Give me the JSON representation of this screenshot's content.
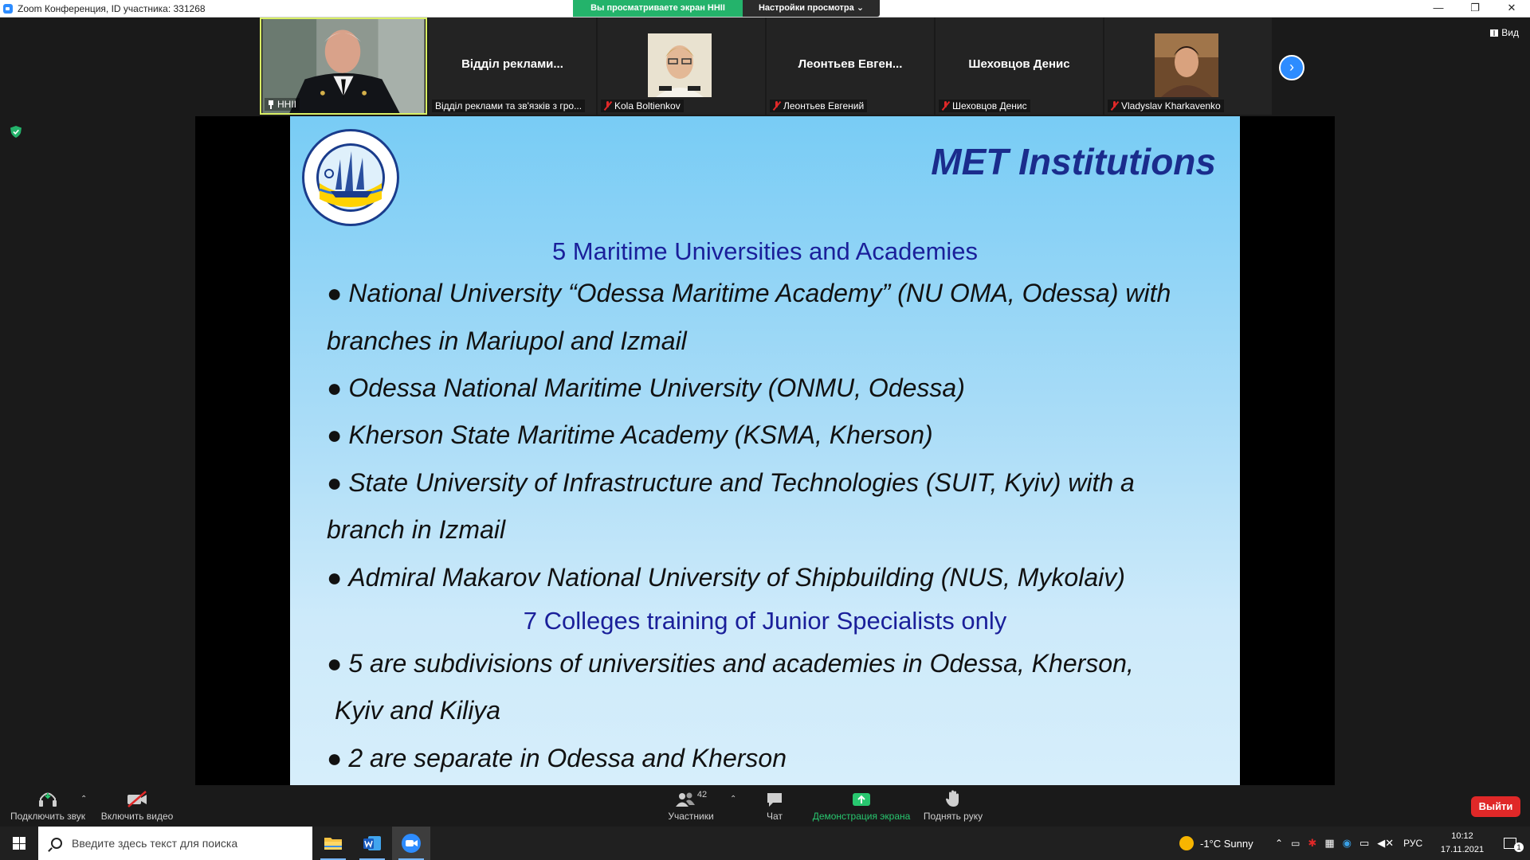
{
  "window": {
    "title": "Zoom Конференция, ID участника: 331268",
    "share_banner": "Вы просматриваете экран HHII",
    "view_options": "Настройки просмотра ⌄",
    "minimize": "—",
    "restore": "❐",
    "close": "✕"
  },
  "gallery": {
    "view_label": "Вид",
    "tiles": [
      {
        "name": "",
        "label": "HHII",
        "type": "video"
      },
      {
        "name": "Відділ  реклами...",
        "label": "Відділ реклами та зв'язків з гро...",
        "type": "name"
      },
      {
        "name": "",
        "label": "Kola Boltienkov",
        "type": "photo"
      },
      {
        "name": "Леонтьев  Евген...",
        "label": "Леонтьев Евгений",
        "type": "name"
      },
      {
        "name": "Шеховцов Денис",
        "label": "Шеховцов Денис",
        "type": "name"
      },
      {
        "name": "",
        "label": "Vladyslav Kharkavenko",
        "type": "photo"
      }
    ]
  },
  "slide": {
    "title": "MET Institutions",
    "heading1": "5 Maritime Universities and Academies",
    "heading2": "7 Colleges training of Junior Specialists only",
    "bullet": "●",
    "items1": [
      "National University “Odessa Maritime Academy” (NU OMA, Odessa) with",
      "branches in Mariupol and Izmail",
      "Odessa National Maritime University  (ONMU, Odessa)",
      "Kherson State Maritime Academy (KSMA, Kherson)",
      "State University of Infrastructure and Technologies (SUIT, Kyiv) with a",
      "branch in Izmail",
      "Admiral Makarov National University of Shipbuilding (NUS, Mykolaiv)"
    ],
    "items2": [
      "5 are subdivisions of universities and academies in Odessa, Kherson,",
      "Kyiv and Kiliya",
      "2 are separate in Odessa and Kherson"
    ]
  },
  "toolbar": {
    "audio": "Подключить звук",
    "video": "Включить видео",
    "participants": "Участники",
    "participants_count": "42",
    "chat": "Чат",
    "share": "Демонстрация экрана",
    "raise_hand": "Поднять руку",
    "leave": "Выйти"
  },
  "taskbar": {
    "search_placeholder": "Введите здесь текст для поиска",
    "weather": "-1°C  Sunny",
    "lang": "РУС",
    "time": "10:12",
    "date": "17.11.2021",
    "notifications": "1"
  },
  "colors": {
    "zoom_blue": "#2d8cff",
    "share_green": "#24b36b",
    "leave_red": "#e02828",
    "slide_title": "#1a2c8c"
  }
}
